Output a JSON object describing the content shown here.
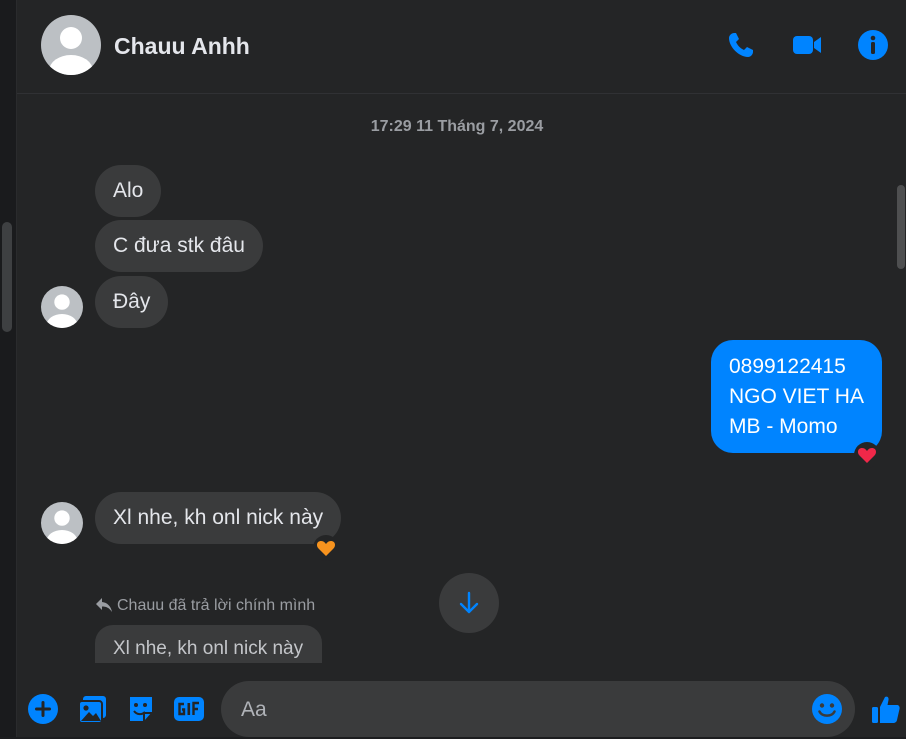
{
  "contact": {
    "name": "Chauu Anhh"
  },
  "header_icons": [
    "phone-icon",
    "video-camera-icon",
    "info-icon"
  ],
  "conversation": {
    "timestamp": "17:29 11 Tháng 7, 2024",
    "incoming": [
      "Alo",
      "C đưa stk đâu",
      "Đây"
    ],
    "outgoing": {
      "lines": [
        "0899122415",
        "NGO VIET HA",
        "MB - Momo"
      ],
      "reaction": "heart-red"
    },
    "incoming_2": {
      "text": "Xl nhe, kh onl nick này",
      "reaction": "heart-orange"
    },
    "reply": {
      "label": "Chauu đã trả lời chính mình",
      "quoted_text": "Xl nhe, kh onl nick này"
    }
  },
  "composer": {
    "placeholder": "Aa",
    "icons": [
      "add-icon",
      "photo-icon",
      "sticker-icon",
      "gif-icon",
      "emoji-icon",
      "like-icon"
    ]
  },
  "colors": {
    "accent": "#0084ff",
    "bubble_in": "#3a3b3c",
    "background": "#242526"
  }
}
